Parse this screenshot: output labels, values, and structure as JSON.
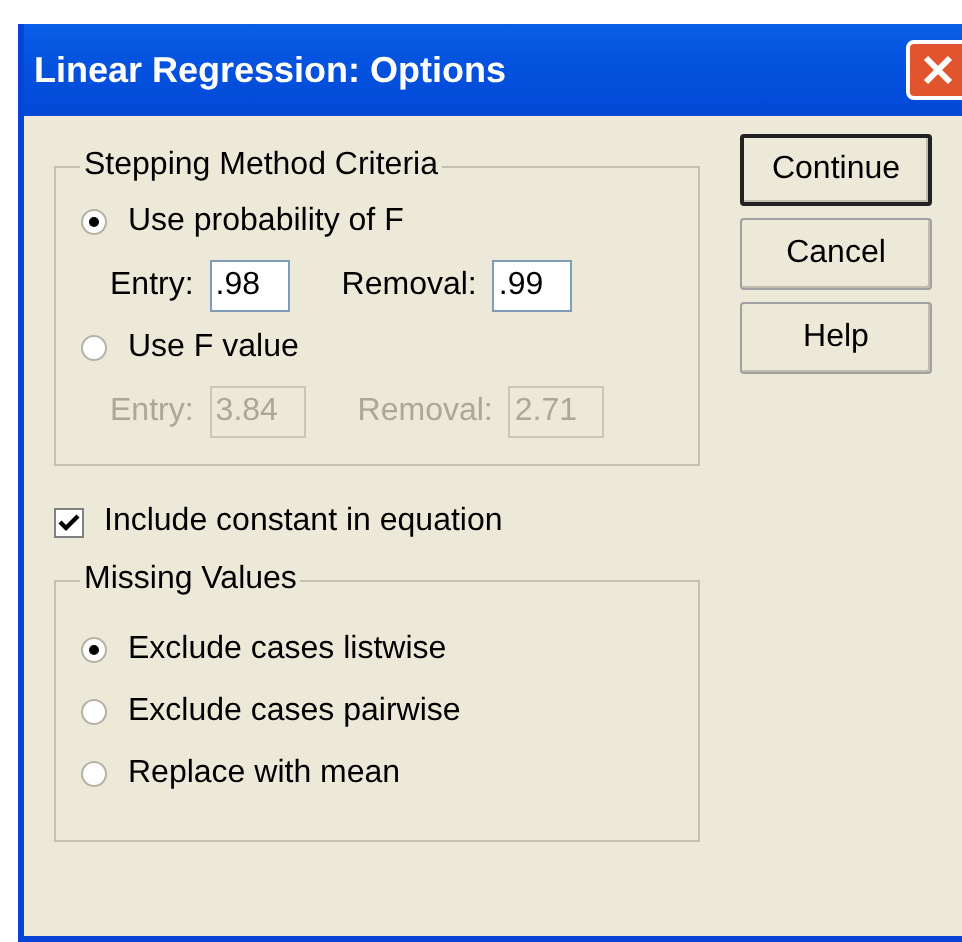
{
  "window": {
    "title": "Linear Regression: Options"
  },
  "stepping_criteria": {
    "legend": "Stepping Method Criteria",
    "options": [
      {
        "label": "Use probability of F",
        "selected": true,
        "disabled": false,
        "entry_label": "Entry:",
        "entry_value": ".98",
        "removal_label": "Removal:",
        "removal_value": ".99"
      },
      {
        "label": "Use F value",
        "selected": false,
        "disabled": true,
        "entry_label": "Entry:",
        "entry_value": "3.84",
        "removal_label": "Removal:",
        "removal_value": "2.71"
      }
    ]
  },
  "include_constant": {
    "label": "Include constant in equation",
    "checked": true
  },
  "missing_values": {
    "legend": "Missing Values",
    "options": [
      {
        "label": "Exclude cases listwise",
        "selected": true
      },
      {
        "label": "Exclude cases pairwise",
        "selected": false
      },
      {
        "label": "Replace with mean",
        "selected": false
      }
    ]
  },
  "buttons": [
    {
      "label": "Continue",
      "default": true
    },
    {
      "label": "Cancel",
      "default": false
    },
    {
      "label": "Help",
      "default": false
    }
  ]
}
